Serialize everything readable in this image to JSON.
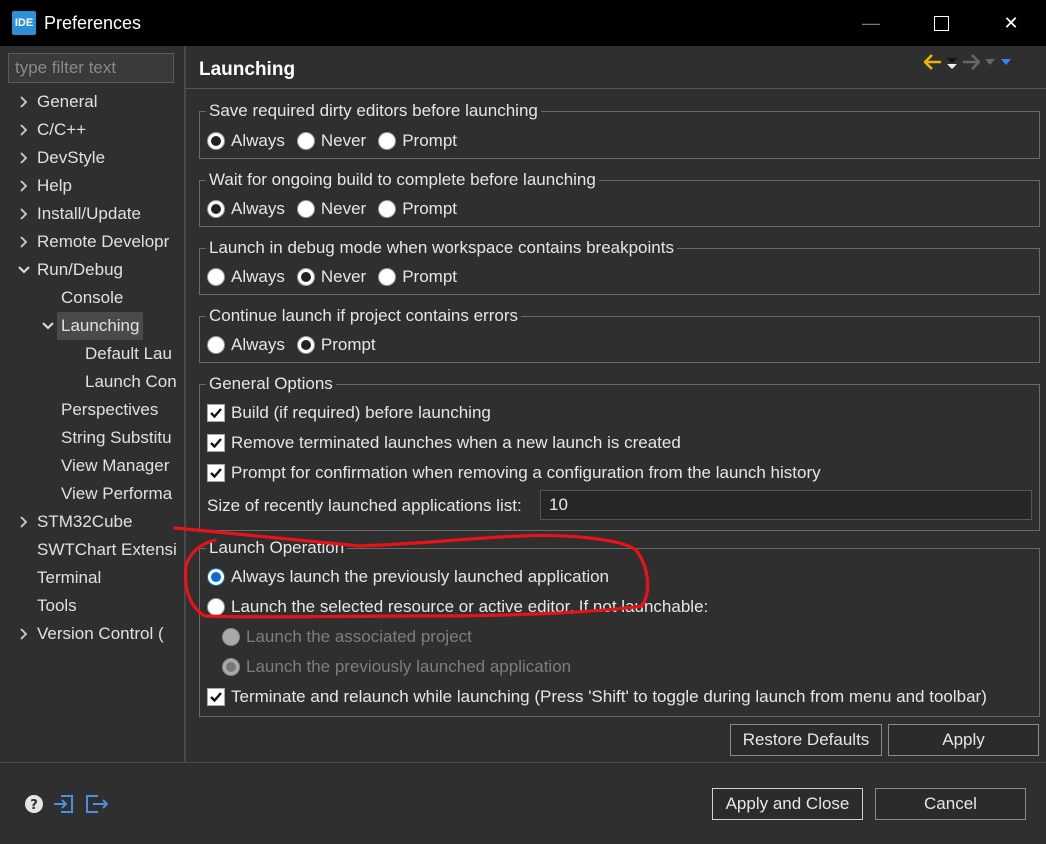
{
  "window": {
    "title": "Preferences",
    "app_badge": "IDE",
    "min_glyph": "—",
    "close_glyph": "✕"
  },
  "filter": {
    "placeholder": "type filter text"
  },
  "tree": [
    {
      "label": "General",
      "expander": "collapsed",
      "depth": 0
    },
    {
      "label": "C/C++",
      "expander": "collapsed",
      "depth": 0
    },
    {
      "label": "DevStyle",
      "expander": "collapsed",
      "depth": 0
    },
    {
      "label": "Help",
      "expander": "collapsed",
      "depth": 0
    },
    {
      "label": "Install/Update",
      "expander": "collapsed",
      "depth": 0
    },
    {
      "label": "Remote Developr",
      "expander": "collapsed",
      "depth": 0
    },
    {
      "label": "Run/Debug",
      "expander": "expanded",
      "depth": 0
    },
    {
      "label": "Console",
      "expander": "none",
      "depth": 1
    },
    {
      "label": "Launching",
      "expander": "expanded",
      "depth": 1,
      "selected": true
    },
    {
      "label": "Default Lau",
      "expander": "none",
      "depth": 2
    },
    {
      "label": "Launch Con",
      "expander": "none",
      "depth": 2
    },
    {
      "label": "Perspectives",
      "expander": "none",
      "depth": 1
    },
    {
      "label": "String Substitu",
      "expander": "none",
      "depth": 1
    },
    {
      "label": "View Manager",
      "expander": "none",
      "depth": 1
    },
    {
      "label": "View Performa",
      "expander": "none",
      "depth": 1
    },
    {
      "label": "STM32Cube",
      "expander": "collapsed",
      "depth": 0
    },
    {
      "label": "SWTChart Extensi",
      "expander": "none",
      "depth": 0
    },
    {
      "label": "Terminal",
      "expander": "none",
      "depth": 0
    },
    {
      "label": "Tools",
      "expander": "none",
      "depth": 0
    },
    {
      "label": "Version Control (",
      "expander": "collapsed",
      "depth": 0
    }
  ],
  "page": {
    "title": "Launching"
  },
  "groups": {
    "save_dirty": {
      "title": "Save required dirty editors before launching",
      "options": [
        {
          "label": "Always",
          "checked": true
        },
        {
          "label": "Never",
          "checked": false
        },
        {
          "label": "Prompt",
          "checked": false
        }
      ]
    },
    "wait_build": {
      "title": "Wait for ongoing build to complete before launching",
      "options": [
        {
          "label": "Always",
          "checked": true
        },
        {
          "label": "Never",
          "checked": false
        },
        {
          "label": "Prompt",
          "checked": false
        }
      ]
    },
    "debug_mode": {
      "title": "Launch in debug mode when workspace contains breakpoints",
      "options": [
        {
          "label": "Always",
          "checked": false
        },
        {
          "label": "Never",
          "checked": true
        },
        {
          "label": "Prompt",
          "checked": false
        }
      ]
    },
    "continue_errors": {
      "title": "Continue launch if project contains errors",
      "options": [
        {
          "label": "Always",
          "checked": false
        },
        {
          "label": "Prompt",
          "checked": true
        }
      ]
    },
    "general": {
      "title": "General Options",
      "build_label": "Build (if required) before launching",
      "remove_label": "Remove terminated launches when a new launch is created",
      "prompt_label": "Prompt for confirmation when removing a configuration from the launch history",
      "size_label": "Size of recently launched applications list:",
      "size_value": "10"
    },
    "launch_op": {
      "title": "Launch Operation",
      "always_label": "Always launch the previously launched application",
      "selected_label": "Launch the selected resource or active editor. If not launchable:",
      "associated_label": "Launch the associated project",
      "previous_label": "Launch the previously launched application",
      "terminate_label": "Terminate and relaunch while launching (Press 'Shift' to toggle during launch from menu and toolbar)"
    }
  },
  "buttons": {
    "restore_defaults": "Restore Defaults",
    "apply": "Apply",
    "apply_close": "Apply and Close",
    "cancel": "Cancel"
  },
  "colors": {
    "annotation": "#e8121a",
    "accent": "#0b6cc9",
    "nav_back": "#f0b400",
    "menu_arrow": "#3b82f6"
  }
}
